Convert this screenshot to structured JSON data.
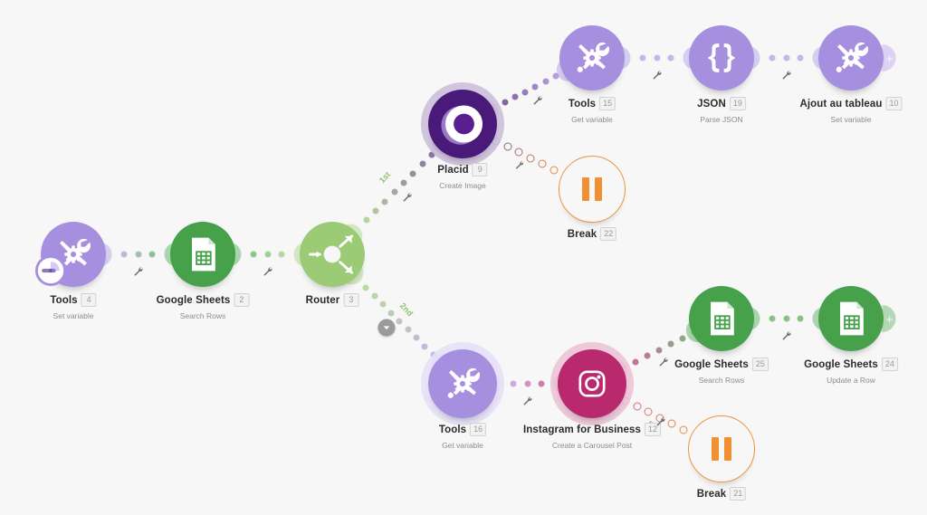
{
  "canvas": {
    "background": "#f7f7f7",
    "accent_green": "#8cc06a",
    "accent_purple": "#a78fe0",
    "accent_orange": "#ef9133",
    "sheets_green": "#47a14b",
    "placid_purple": "#4a1a7a",
    "instagram_pink": "#b9296e"
  },
  "route_labels": [
    {
      "name": "route-1st",
      "text": "1st"
    },
    {
      "name": "route-2nd",
      "text": "2nd"
    }
  ],
  "collapse_toggle": {
    "name": "collapse-toggle",
    "icon": "chevron-down-icon"
  },
  "add_ports": [
    {
      "name": "add-module-top",
      "label": "+"
    },
    {
      "name": "add-module-bottom",
      "label": "+"
    }
  ],
  "nodes": [
    {
      "id": "tools-4",
      "name": "module-tools-set-variable",
      "title": "Tools",
      "badge": "4",
      "subtitle": "Set variable",
      "icon": "tools-icon",
      "color": "#a78fe0",
      "has_scheduler_badge": true
    },
    {
      "id": "google-sheets-2",
      "name": "module-google-sheets-search-rows",
      "title": "Google Sheets",
      "badge": "2",
      "subtitle": "Search Rows",
      "icon": "google-sheets-icon",
      "color": "#47a14b"
    },
    {
      "id": "router-3",
      "name": "module-router",
      "title": "Router",
      "badge": "3",
      "subtitle": "",
      "icon": "router-icon",
      "color": "#9ccb76"
    },
    {
      "id": "placid-9",
      "name": "module-placid-create-image",
      "title": "Placid",
      "badge": "9",
      "subtitle": "Create Image",
      "icon": "placid-icon",
      "color": "#4a1a7a"
    },
    {
      "id": "tools-15",
      "name": "module-tools-get-variable-top",
      "title": "Tools",
      "badge": "15",
      "subtitle": "Get variable",
      "icon": "tools-icon",
      "color": "#a78fe0"
    },
    {
      "id": "json-19",
      "name": "module-json-parse-json",
      "title": "JSON",
      "badge": "19",
      "subtitle": "Parse JSON",
      "icon": "json-braces-icon",
      "color": "#a78fe0"
    },
    {
      "id": "ajout-10",
      "name": "module-ajout-au-tableau-set-variable",
      "title": "Ajout au tableau",
      "badge": "10",
      "subtitle": "Set variable",
      "icon": "tools-icon",
      "color": "#a78fe0"
    },
    {
      "id": "break-22",
      "name": "module-break-top",
      "title": "Break",
      "badge": "22",
      "subtitle": "",
      "icon": "pause-icon",
      "color": "#ef9133"
    },
    {
      "id": "tools-16",
      "name": "module-tools-get-variable-bottom",
      "title": "Tools",
      "badge": "16",
      "subtitle": "Get variable",
      "icon": "tools-icon",
      "color": "#a78fe0"
    },
    {
      "id": "instagram-12",
      "name": "module-instagram-for-business-create-carousel-post",
      "title": "Instagram for Business",
      "badge": "12",
      "subtitle": "Create a Carousel Post",
      "icon": "instagram-icon",
      "color": "#b9296e",
      "badge_has_wrench": true
    },
    {
      "id": "google-sheets-25",
      "name": "module-google-sheets-search-rows-bottom",
      "title": "Google Sheets",
      "badge": "25",
      "subtitle": "Search Rows",
      "icon": "google-sheets-icon",
      "color": "#47a14b"
    },
    {
      "id": "google-sheets-24",
      "name": "module-google-sheets-update-a-row",
      "title": "Google Sheets",
      "badge": "24",
      "subtitle": "Update a Row",
      "icon": "google-sheets-icon",
      "color": "#47a14b"
    },
    {
      "id": "break-21",
      "name": "module-break-bottom",
      "title": "Break",
      "badge": "21",
      "subtitle": "",
      "icon": "pause-icon",
      "color": "#ef9133"
    }
  ]
}
